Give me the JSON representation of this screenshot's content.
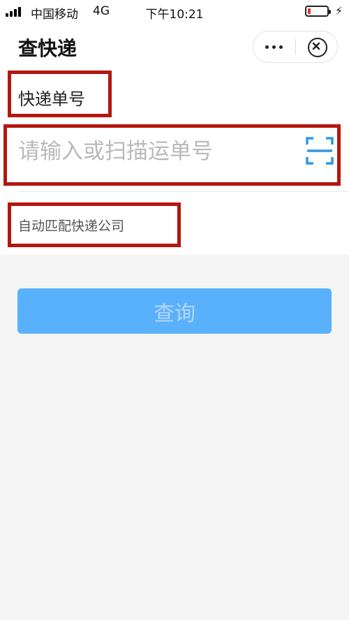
{
  "status_bar": {
    "carrier": "中国移动",
    "network": "4G",
    "time": "下午10:21",
    "battery_level": 0.15,
    "battery_color": "#e33333"
  },
  "nav": {
    "title": "查快递",
    "icons": {
      "more": "more-dots-icon",
      "close": "close-circle-icon"
    }
  },
  "form": {
    "tracking_label": "快递单号",
    "tracking_input": {
      "value": "",
      "placeholder": "请输入或扫描运单号"
    },
    "scan_icon": "scan-icon",
    "company_text": "自动匹配快递公司",
    "query_button": "查询"
  },
  "colors": {
    "highlight": "#b3170f",
    "button": "#5ab1fb",
    "scan_accent": "#2f97e6"
  }
}
